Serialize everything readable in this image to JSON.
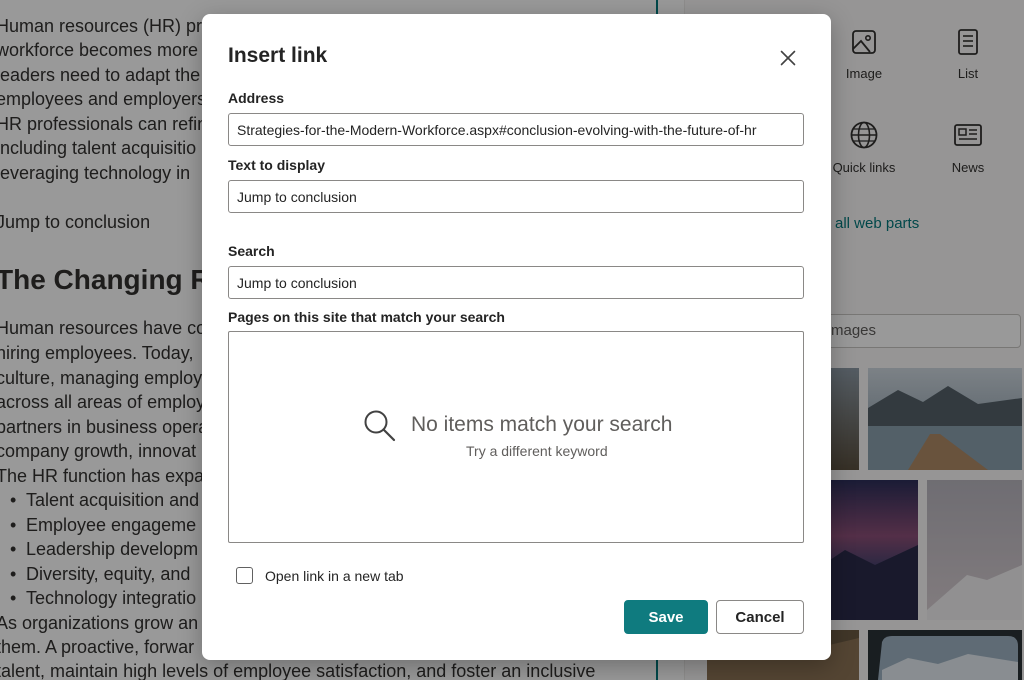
{
  "background": {
    "paragraph_lines": [
      "Human resources (HR) pro",
      "workforce becomes more",
      "leaders need to adapt the",
      "employees and employers",
      "HR professionals can refin",
      "including talent acquisitio",
      "leveraging technology in"
    ],
    "jump_link": "Jump to conclusion",
    "heading": "The Changing R",
    "paragraph2_lines": [
      "Human resources have co",
      "hiring employees. Today,",
      "culture, managing employ",
      "across all areas of employ",
      "partners in business opera",
      "company growth, innovat",
      "The HR function has expa"
    ],
    "bullets": [
      "Talent acquisition and",
      "Employee engageme",
      "Leadership developm",
      "Diversity, equity, and",
      "Technology integratio"
    ],
    "closing_lines": [
      "As organizations grow an",
      "them. A proactive, forwar",
      "talent, maintain high levels of employee satisfaction, and foster an inclusive"
    ]
  },
  "toolbox": {
    "webparts": [
      {
        "label": "Image",
        "icon": "image-icon"
      },
      {
        "label": "List",
        "icon": "list-icon"
      },
      {
        "label": "Quick links",
        "icon": "globe-icon"
      },
      {
        "label": "News",
        "icon": "news-icon"
      }
    ],
    "see_all": "all web parts",
    "image_search": "mages"
  },
  "dialog": {
    "title": "Insert link",
    "address_label": "Address",
    "address_value": "Strategies-for-the-Modern-Workforce.aspx#conclusion-evolving-with-the-future-of-hr",
    "display_label": "Text to display",
    "display_value": "Jump to conclusion",
    "search_label": "Search",
    "search_value": "Jump to conclusion",
    "results_label": "Pages on this site that match your search",
    "empty_title": "No items match your search",
    "empty_subtitle": "Try a different keyword",
    "new_tab_label": "Open link in a new tab",
    "save_label": "Save",
    "cancel_label": "Cancel"
  },
  "colors": {
    "accent": "#0f7b7f",
    "link": "#03787c"
  }
}
